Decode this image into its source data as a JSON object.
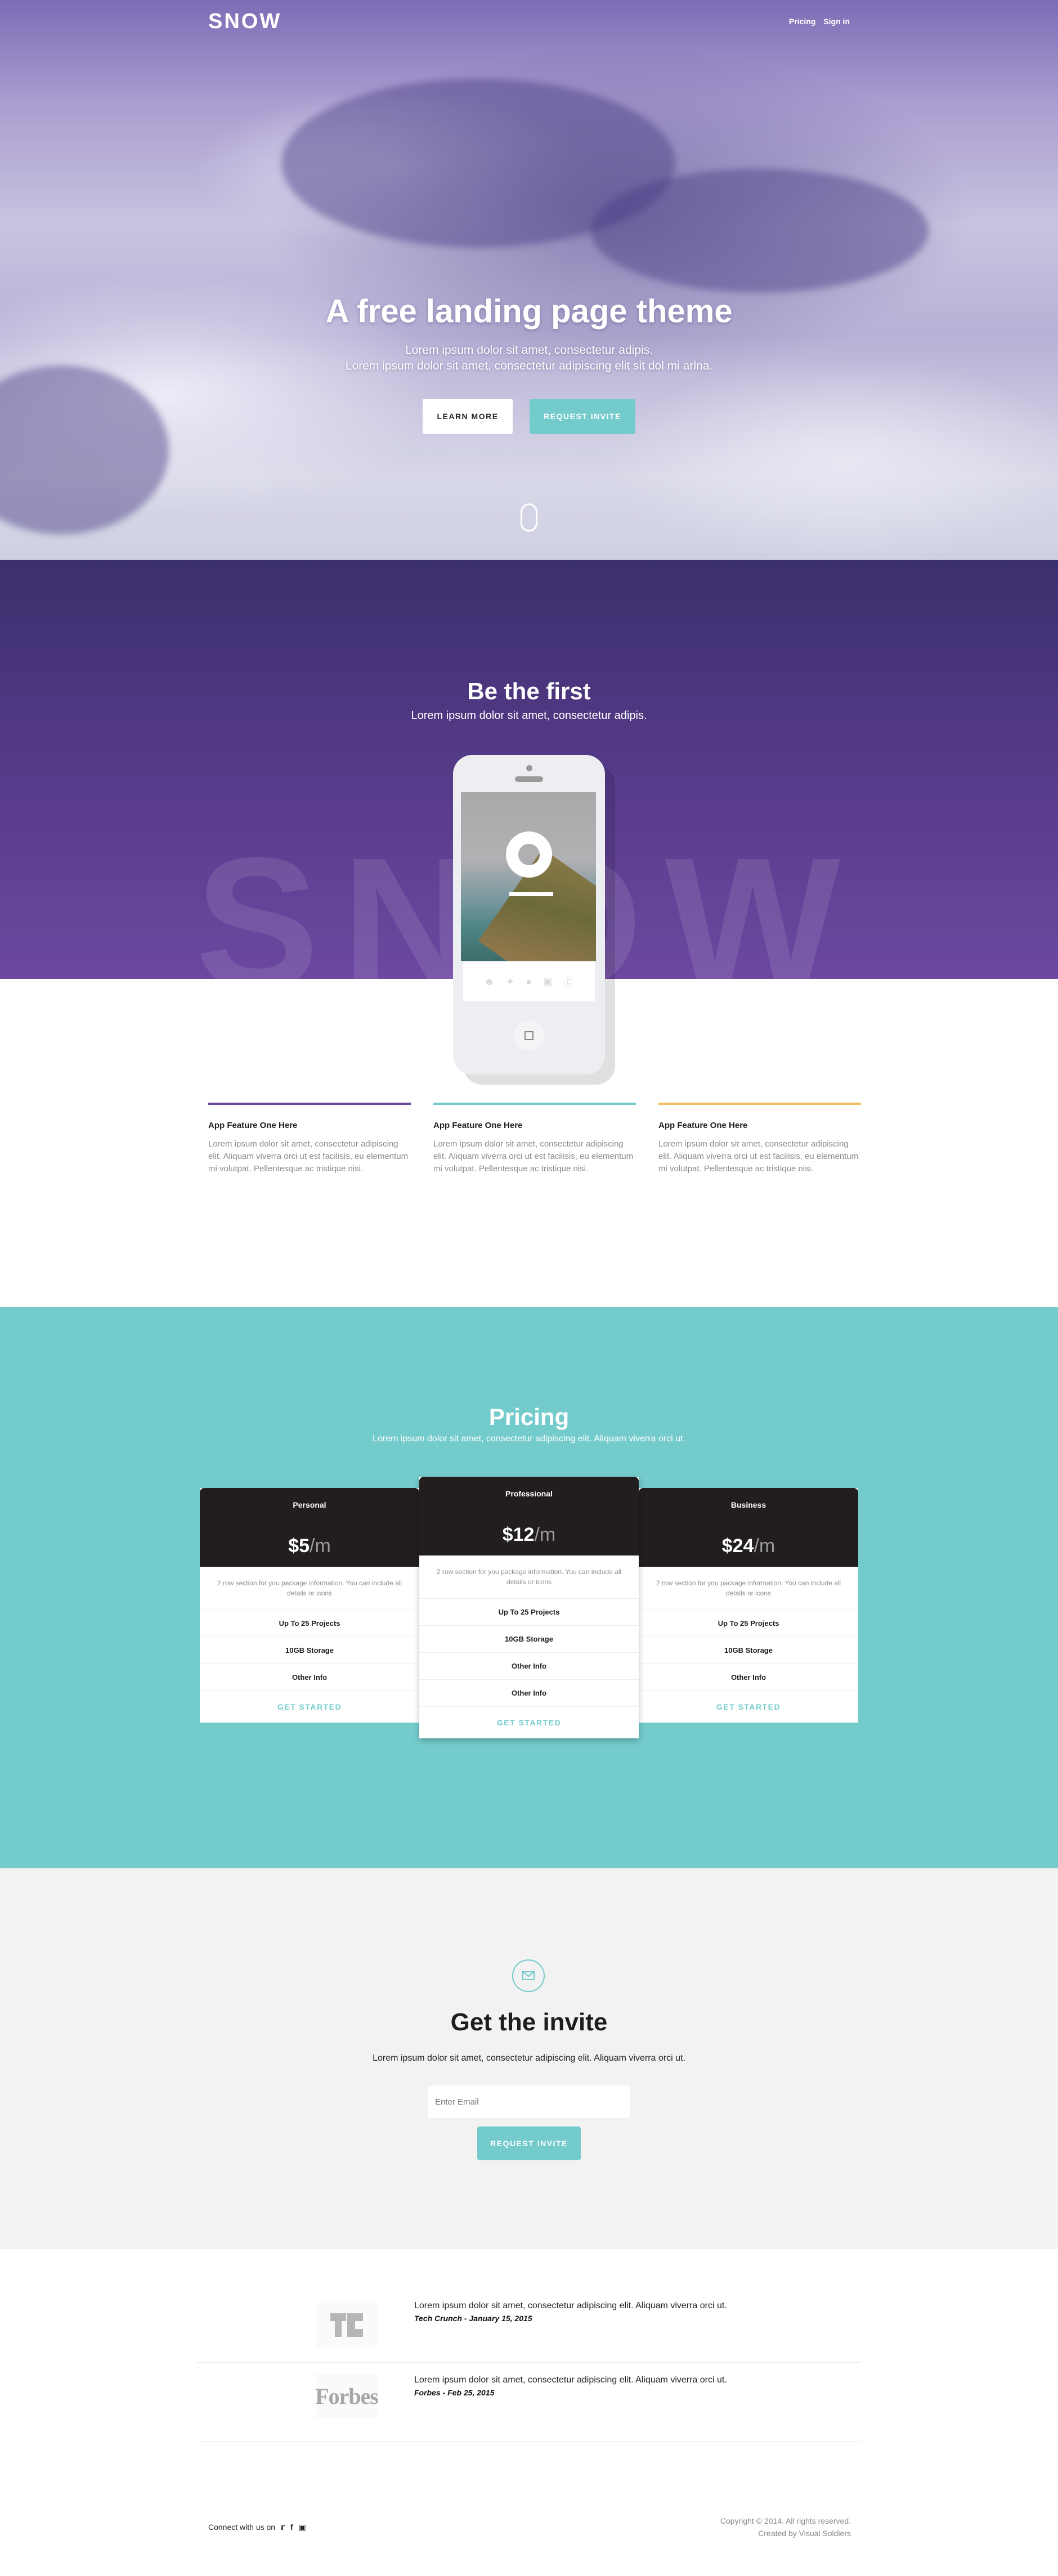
{
  "nav": {
    "logo": "SNOW",
    "links": [
      "Pricing",
      "Sign in"
    ]
  },
  "hero": {
    "title": "A free landing page theme",
    "subtitle_line1": "Lorem ipsum dolor sit amet, consectetur adipis.",
    "subtitle_line2": "Lorem ipsum dolor sit amet, consectetur adipiscing elit sit dol mi arlna.",
    "learn_more": "LEARN MORE",
    "request_invite": "REQUEST INVITE"
  },
  "intro": {
    "title": "Be the first",
    "subtitle": "Lorem ipsum dolor sit amet, consectetur adipis.",
    "watermark": "SNOW",
    "phone_share_icons": [
      "user-icon",
      "twitter-icon",
      "facebook-icon",
      "instagram-icon",
      "skype-icon"
    ]
  },
  "features": [
    {
      "title": "App Feature One Here",
      "text": "Lorem ipsum dolor sit amet, consectetur adipiscing elit. Aliquam viverra orci ut est facilisis, eu elementum mi volutpat. Pellentesque ac tristique nisi.",
      "color": "#6a4b9c"
    },
    {
      "title": "App Feature One Here",
      "text": "Lorem ipsum dolor sit amet, consectetur adipiscing elit. Aliquam viverra orci ut est facilisis, eu elementum mi volutpat. Pellentesque ac tristique nisi.",
      "color": "#74cbcc"
    },
    {
      "title": "App Feature One Here",
      "text": "Lorem ipsum dolor sit amet, consectetur adipiscing elit. Aliquam viverra orci ut est facilisis, eu elementum mi volutpat. Pellentesque ac tristique nisi.",
      "color": "#f3bf5a"
    }
  ],
  "pricing": {
    "title": "Pricing",
    "subtitle": "Lorem ipsum dolor sit amet, consectetur adipiscing elit. Aliquam viverra orci ut.",
    "plans": [
      {
        "name": "Personal",
        "price": "$5",
        "period": "/m",
        "desc": "2 row section for you package information. You can include all details or icons",
        "features": [
          "Up To 25 Projects",
          "10GB Storage",
          "Other Info"
        ],
        "cta": "GET STARTED"
      },
      {
        "name": "Professional",
        "price": "$12",
        "period": "/m",
        "desc": "2 row section for you package information. You can include all details or icons",
        "features": [
          "Up To 25 Projects",
          "10GB Storage",
          "Other Info",
          "Other Info"
        ],
        "cta": "GET STARTED"
      },
      {
        "name": "Business",
        "price": "$24",
        "period": "/m",
        "desc": "2 row section for you package information. You can include all details or icons",
        "features": [
          "Up To 25 Projects",
          "10GB Storage",
          "Other Info"
        ],
        "cta": "GET STARTED"
      }
    ]
  },
  "invite": {
    "title": "Get the invite",
    "subtitle": "Lorem ipsum dolor sit amet, consectetur adipiscing elit. Aliquam viverra orci ut.",
    "email_placeholder": "Enter Email",
    "button": "REQUEST INVITE"
  },
  "press": [
    {
      "logo": "TC",
      "text": "Lorem ipsum dolor sit amet, consectetur adipiscing elit. Aliquam viverra orci ut.",
      "source": "Tech Crunch - January 15, 2015"
    },
    {
      "logo": "Forbes",
      "text": "Lorem ipsum dolor sit amet, consectetur adipiscing elit. Aliquam viverra orci ut.",
      "source": "Forbes - Feb 25, 2015"
    }
  ],
  "footer": {
    "connect": "Connect with us on",
    "copyright": "Copyright © 2014. All rights reserved.",
    "credit": "Created by Visual Soldiers"
  },
  "colors": {
    "teal": "#74cbcc",
    "purple": "#5a3d8e",
    "dark": "#221e1f",
    "yellow": "#f3bf5a"
  }
}
